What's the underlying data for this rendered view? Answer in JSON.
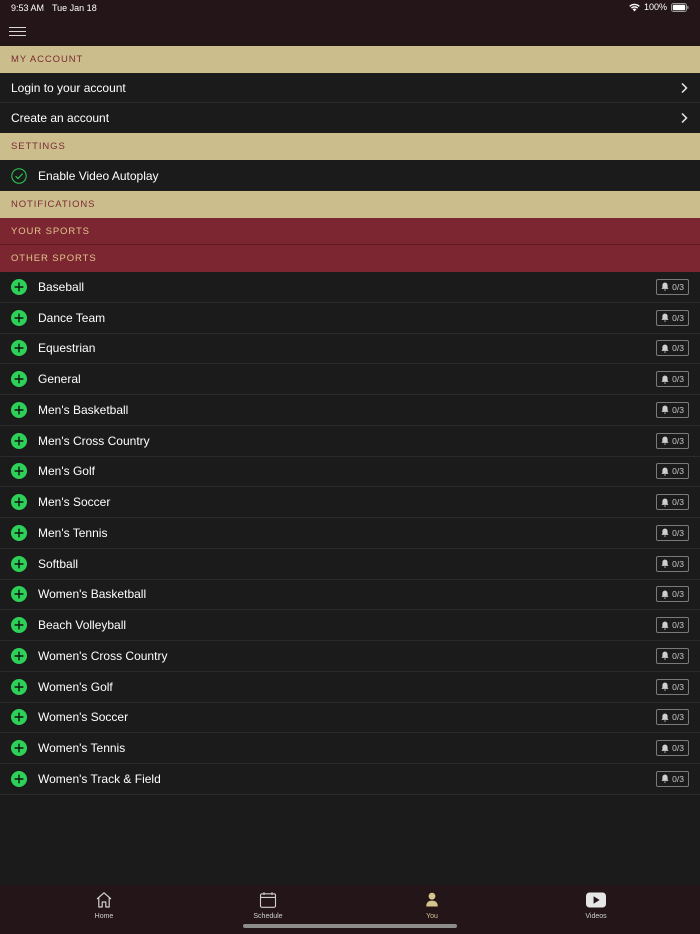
{
  "status": {
    "time": "9:53 AM",
    "date": "Tue Jan 18",
    "battery": "100%"
  },
  "sections": {
    "my_account": "MY ACCOUNT",
    "settings": "SETTINGS",
    "notifications": "NOTIFICATIONS",
    "your_sports": "YOUR SPORTS",
    "other_sports": "OTHER SPORTS"
  },
  "account": {
    "login": "Login to your account",
    "create": "Create an account"
  },
  "settings": {
    "autoplay": "Enable Video Autoplay"
  },
  "sports": [
    {
      "name": "Baseball",
      "count": "0/3"
    },
    {
      "name": "Dance Team",
      "count": "0/3"
    },
    {
      "name": "Equestrian",
      "count": "0/3"
    },
    {
      "name": "General",
      "count": "0/3"
    },
    {
      "name": "Men's Basketball",
      "count": "0/3"
    },
    {
      "name": "Men's Cross Country",
      "count": "0/3"
    },
    {
      "name": "Men's Golf",
      "count": "0/3"
    },
    {
      "name": "Men's Soccer",
      "count": "0/3"
    },
    {
      "name": "Men's Tennis",
      "count": "0/3"
    },
    {
      "name": "Softball",
      "count": "0/3"
    },
    {
      "name": "Women's Basketball",
      "count": "0/3"
    },
    {
      "name": "Beach Volleyball",
      "count": "0/3"
    },
    {
      "name": "Women's Cross Country",
      "count": "0/3"
    },
    {
      "name": "Women's Golf",
      "count": "0/3"
    },
    {
      "name": "Women's Soccer",
      "count": "0/3"
    },
    {
      "name": "Women's Tennis",
      "count": "0/3"
    },
    {
      "name": "Women's Track & Field",
      "count": "0/3"
    }
  ],
  "tabs": {
    "home": "Home",
    "schedule": "Schedule",
    "you": "You",
    "videos": "Videos"
  },
  "colors": {
    "tan_header": "#cbbe8c",
    "maroon_header": "#7c2631",
    "accent_green": "#2ed158",
    "tab_active": "#d6c48e"
  }
}
